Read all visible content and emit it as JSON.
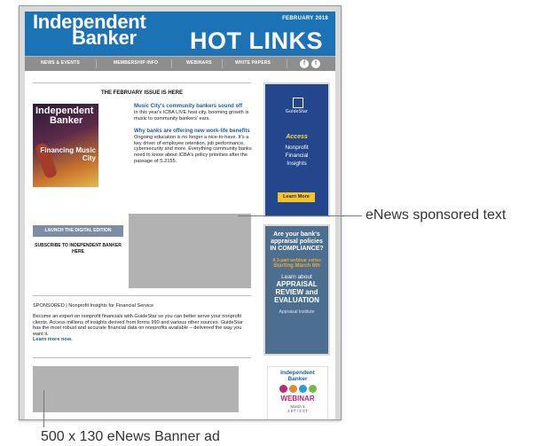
{
  "header": {
    "title_line1": "Independent",
    "title_line2": "Banker",
    "hot_links": "HOT LINKS",
    "date": "FEBRUARY 2018"
  },
  "nav": {
    "items": [
      "NEWS & EVENTS",
      "MEMBERSHIP INFO",
      "WEBINARS",
      "WHITE PAPERS"
    ],
    "social": [
      "f",
      "t"
    ]
  },
  "issue": {
    "heading": "THE FEBRUARY ISSUE IS HERE",
    "cover_title_1": "Independent",
    "cover_title_2": "Banker",
    "cover_feature": "Financing Music City",
    "launch_button": "LAUNCH THE DIGITAL EDITION",
    "subscribe": "SUBSCRIBE TO INDEPENDENT BANKER HERE"
  },
  "articles": [
    {
      "title": "Music City's community bankers sound off",
      "body": "In this year's ICBA LIVE host city, booming growth is music to community bankers' ears."
    },
    {
      "title": "Why banks are offering new work-life benefits",
      "body": "Ongoing education is no longer a nice-to-have. It's a key driver of employee retention, job performance, cybersecurity and more. Everything community banks need to know about ICBA's policy priorities after the passage of S.2155."
    }
  ],
  "sponsored": {
    "heading": "SPONSORED | Nonprofit Insights for Financial Service",
    "body": "Become an expert on nonprofit financials with GuideStar so you can better serve your nonprofit clients. Access millions of insights derived from forms 990 and various other sources. GuideStar has the most robust and accurate financial data on nonprofits available – delivered the way you want it.",
    "link": "Learn more now."
  },
  "side_ads": {
    "guidestar": {
      "logo": "GuideStar",
      "access": "Access",
      "line1": "Nonprofit",
      "line2": "Financial",
      "line3": "Insights",
      "button": "Learn More"
    },
    "appraisal": {
      "q1": "Are your bank's",
      "q2": "appraisal policies",
      "q3": "IN COMPLIANCE?",
      "small": "A 3-part webinar series",
      "start": "Starting March 6th",
      "learn": "Learn about",
      "big1": "APPRAISAL",
      "big2": "REVIEW and",
      "big3": "EVALUATION",
      "org": "Appraisal Institute"
    },
    "webinar": {
      "brand1": "Independent",
      "brand2": "Banker",
      "label": "WEBINAR",
      "date": "March 6",
      "time": "3 ET / 2 CT"
    }
  },
  "callouts": {
    "sponsored_text": "eNews sponsored text",
    "banner_ad": "500 x 130 eNews Banner ad"
  },
  "colors": {
    "header_blue": "#1b73b6",
    "nav_grey": "#8e8e8e",
    "link_blue": "#1b5fa8",
    "placeholder_grey": "#b2b2b2"
  }
}
